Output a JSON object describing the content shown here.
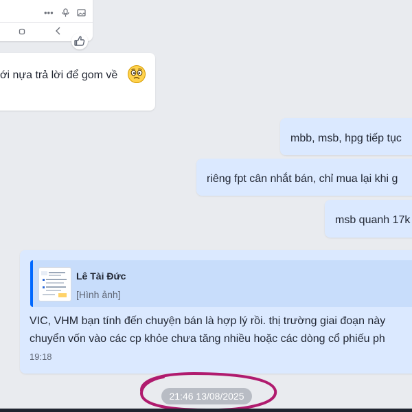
{
  "top_card": {
    "icons": [
      "more-icon",
      "mic-icon",
      "image-icon",
      "home-icon",
      "back-icon"
    ]
  },
  "reaction": {
    "icon": "thumbs-up-icon"
  },
  "messages": {
    "left_message": "ới nựa trả lời để gom về",
    "right_1": "mbb, msb, hpg tiếp tục",
    "right_2": "riêng fpt cân nhắt bán, chỉ mua lại khi g",
    "right_3": "msb quanh 17k"
  },
  "quote": {
    "sender": "Lê Tài Đức",
    "attachment_label": "[Hình ảnh]",
    "text_line_1": "VIC, VHM  bạn tính đến chuyện bán là hợp lý rồi. thị trường giai đoạn này",
    "text_line_2": "chuyển vốn vào các cp khỏe chưa tăng nhiều hoặc các dòng cổ phiếu ph",
    "time": "19:18"
  },
  "date_separator": "21:46 13/08/2025",
  "colors": {
    "background": "#e9ebef",
    "sent_bubble": "#dbe9ff",
    "quote_accent": "#0068ff",
    "annotation": "#b01b6e"
  }
}
